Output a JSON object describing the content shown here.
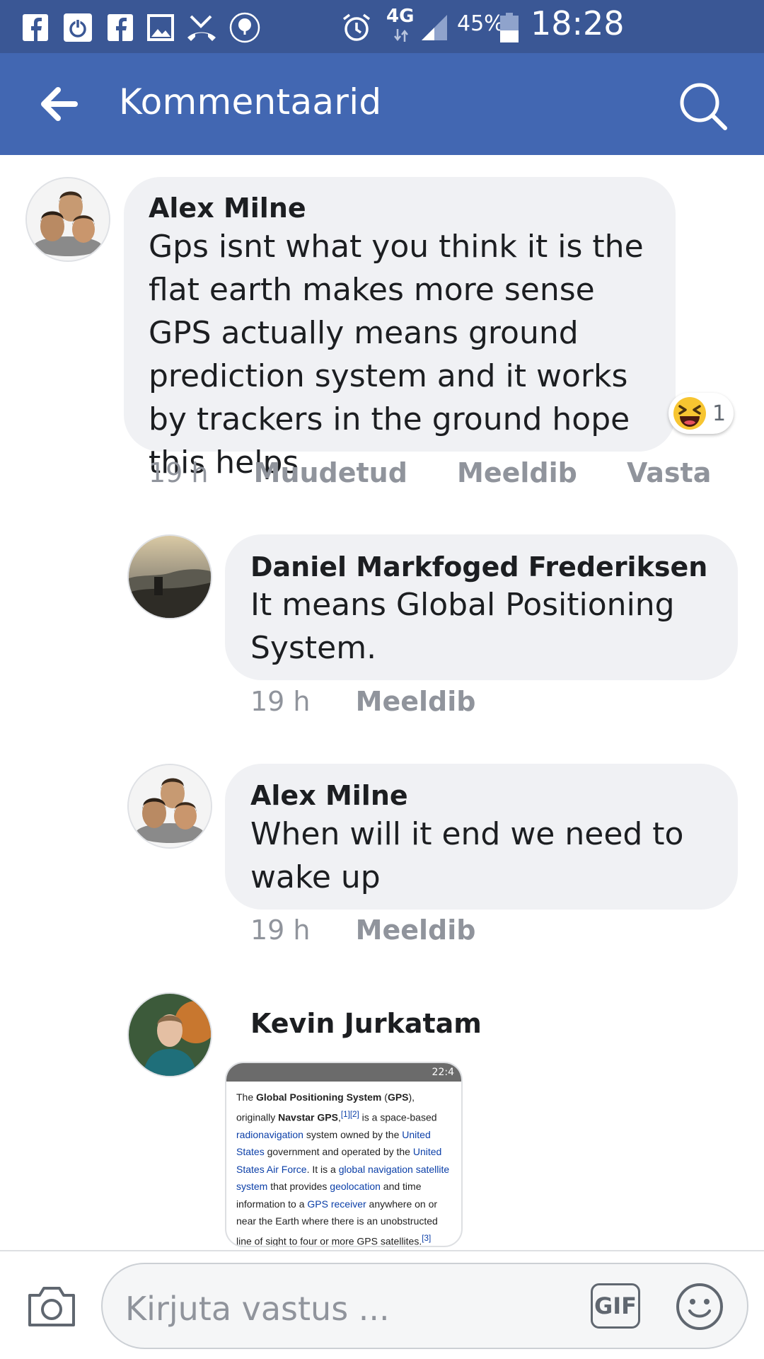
{
  "status_bar": {
    "network": "4G",
    "battery": "45%",
    "time": "18:28",
    "icons": [
      "facebook-icon",
      "power-icon",
      "facebook-icon",
      "gallery-icon",
      "missed-call-icon",
      "tree-seal-icon",
      "alarm-icon",
      "signal-icon",
      "battery-icon"
    ]
  },
  "app_bar": {
    "title": "Kommentaarid",
    "back_icon": "arrow-left-icon",
    "search_icon": "search-icon"
  },
  "comments": [
    {
      "author": "Alex Milne",
      "text": "Gps isnt what you think it is the flat earth makes more sense GPS actually means ground prediction system and it works by trackers in the ground hope this helps",
      "time": "19 h",
      "edited": "Muudetud",
      "like": "Meeldib",
      "reply": "Vasta",
      "reaction": {
        "icon": "laughing-emoji-icon",
        "count": "1"
      }
    },
    {
      "author": "Daniel Markfoged Frederiksen",
      "text": "It means Global Positioning System.",
      "time": "19 h",
      "like": "Meeldib"
    },
    {
      "author": "Alex Milne",
      "text": "When will it end we need to wake up",
      "time": "19 h",
      "like": "Meeldib"
    },
    {
      "author": "Kevin Jurkatam",
      "attachment": {
        "statusbar_text": "22:4",
        "t1": "The ",
        "b1": "Global Positioning System",
        "t2": " (",
        "b2": "GPS",
        "t3": "), originally ",
        "b3": "Navstar GPS",
        "t4": ",",
        "ref1": "[1][2]",
        "t5": " is a space-based ",
        "l1": "radionavigation",
        "t6": " system owned by the ",
        "l2": "United States",
        "t7": " government and operated by the ",
        "l3": "United States Air Force",
        "t8": ". It is a ",
        "l4": "global navigation satellite system",
        "t9": " that provides ",
        "l5": "geolocation",
        "t10": " and time information to a ",
        "l6": "GPS receiver",
        "t11": " anywhere on or near the Earth where there is an unobstructed line of sight to four or more GPS satellites.",
        "ref2": "[3]"
      }
    }
  ],
  "composer": {
    "placeholder": "Kirjuta vastus ...",
    "gif_label": "GIF",
    "camera_icon": "camera-icon",
    "emoji_icon": "smiley-icon"
  },
  "colors": {
    "status_bar": "#3a5795",
    "app_bar": "#4267b2",
    "bubble": "#f0f1f4",
    "meta_text": "#90949c",
    "link": "#0b3fa8"
  }
}
